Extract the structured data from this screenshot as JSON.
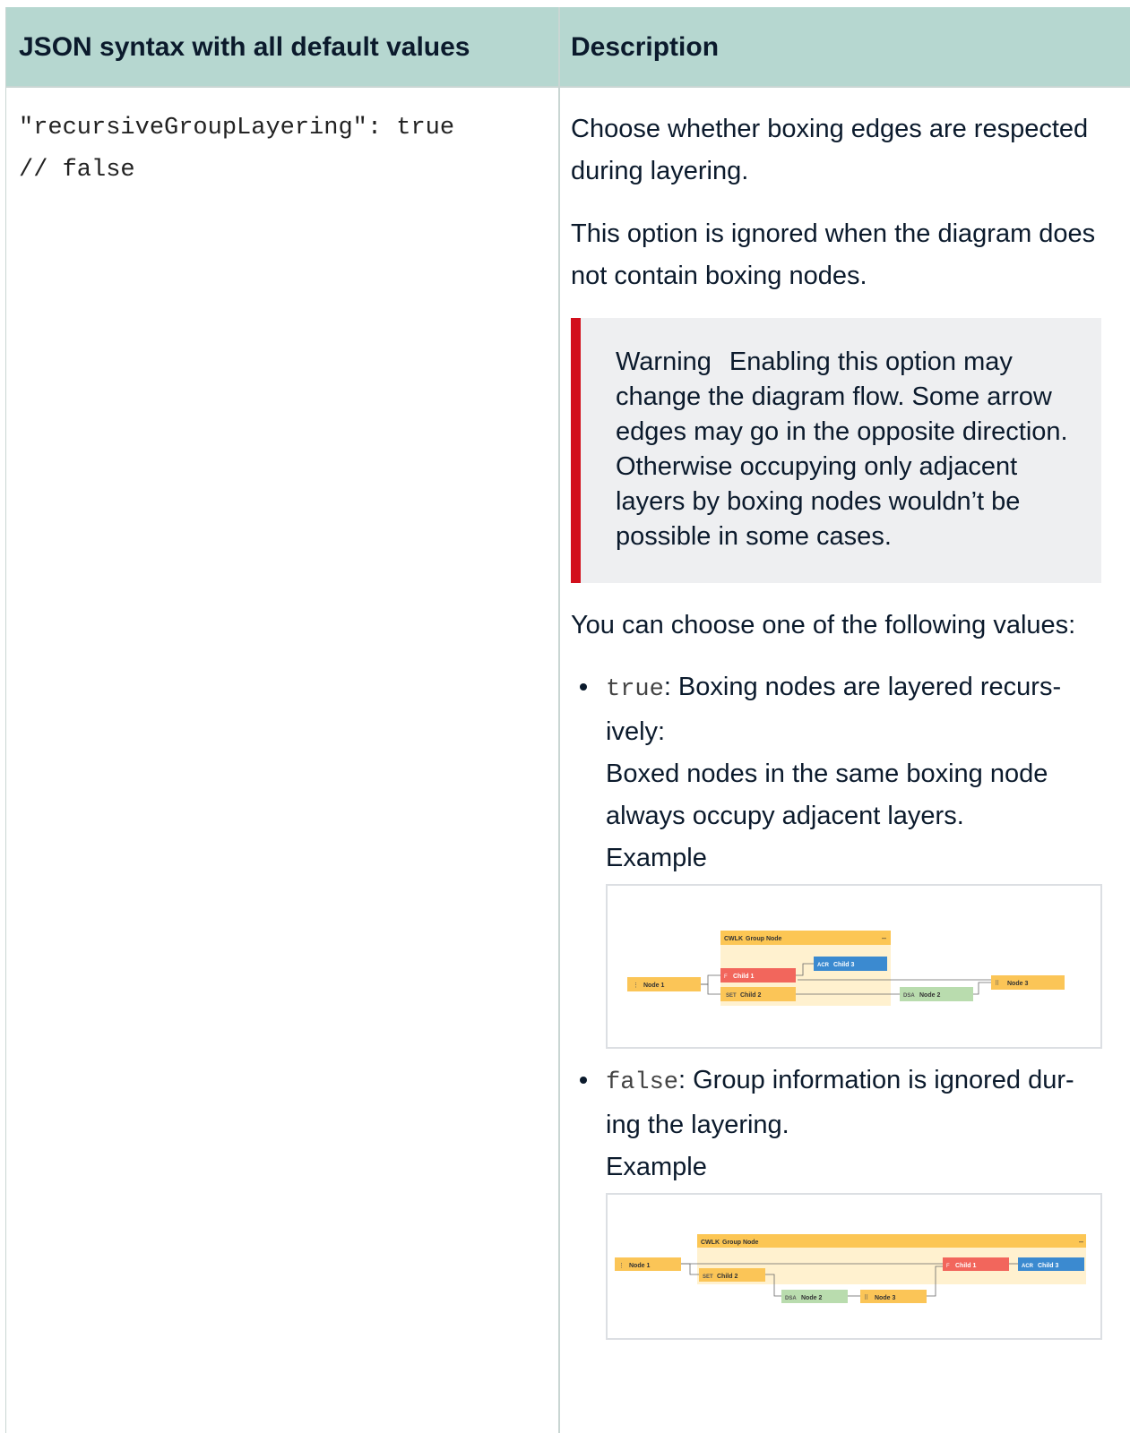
{
  "table": {
    "headers": [
      "JSON syntax with all default values",
      "Description"
    ]
  },
  "code": {
    "line1": "\"recursiveGroupLayering\": true",
    "line2": "// false"
  },
  "description": {
    "intro": "Choose whether boxing edges are respected during layering.",
    "note": "This option is ignored when the diagram does not contain boxing nodes.",
    "warning": {
      "label": "Warning",
      "text": "Enabling this option may change the diagram flow. Some arrow edges may go in the opposite direction. Otherwise occupying only adjacent layers by boxing nodes wouldn’t be possible in some cases."
    },
    "choose_text": "You can choose one of the following values:",
    "options": [
      {
        "value": "true",
        "text": ": Boxing nodes are layered recurs-ively:",
        "detail": "Boxed nodes in the same boxing node always occupy adjacent layers.",
        "example_label": "Example"
      },
      {
        "value": "false",
        "text": ": Group information is ignored dur-ing the layering.",
        "example_label": "Example"
      }
    ]
  },
  "diagram1": {
    "group_tag": "CWLK",
    "group_label": "Group Node",
    "collapse": "–",
    "node1": "Node 1",
    "node1_tag": "⋮",
    "child1": "Child 1",
    "child1_tag": "F",
    "child2": "Child 2",
    "child2_tag": "SET",
    "child3": "Child 3",
    "child3_tag": "ACR",
    "node2": "Node 2",
    "node2_tag": "DSA",
    "node3": "Node 3",
    "node3_tag": "⠿",
    "colors": {
      "group": "#fcc654",
      "group_bg": "#fff1cf",
      "orange": "#fbc557",
      "red": "#f2665c",
      "blue": "#3b8ad0",
      "green": "#b9dcae"
    }
  },
  "diagram2": {
    "group_tag": "CWLK",
    "group_label": "Group Node",
    "collapse": "–",
    "node1": "Node 1",
    "node1_tag": "⋮",
    "child1": "Child 1",
    "child1_tag": "F",
    "child2": "Child 2",
    "child2_tag": "SET",
    "child3": "Child 3",
    "child3_tag": "ACR",
    "node2": "Node 2",
    "node2_tag": "DSA",
    "node3": "Node 3",
    "node3_tag": "⠿"
  }
}
